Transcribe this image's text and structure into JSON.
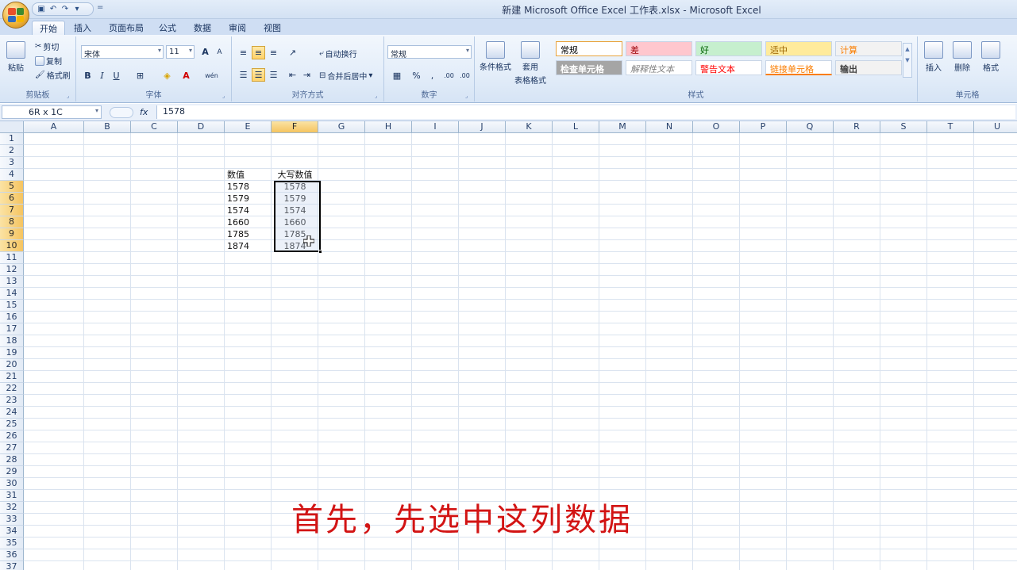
{
  "window": {
    "title": "新建 Microsoft Office Excel 工作表.xlsx - Microsoft Excel"
  },
  "qat": {
    "more": "="
  },
  "tabs": [
    "开始",
    "插入",
    "页面布局",
    "公式",
    "数据",
    "审阅",
    "视图"
  ],
  "ribbon": {
    "clipboard": {
      "label": "剪贴板",
      "paste": "粘贴",
      "cut": "剪切",
      "copy": "复制",
      "format_painter": "格式刷"
    },
    "font": {
      "label": "字体",
      "name": "宋体",
      "size": "11",
      "grow": "A",
      "shrink": "A",
      "bold": "B",
      "italic": "I",
      "underline": "U",
      "phonetic": "wén"
    },
    "alignment": {
      "label": "对齐方式",
      "wrap_text": "自动换行",
      "merge_center": "合并后居中"
    },
    "number": {
      "label": "数字",
      "format": "常规",
      "percent": "%",
      "comma": ",",
      "inc_decimal": ".00",
      "dec_decimal": ".00"
    },
    "styles": {
      "label": "样式",
      "conditional_format": "条件格式",
      "table_format_line1": "套用",
      "table_format_line2": "表格格式",
      "gallery": [
        {
          "name": "常规",
          "bg": "#ffffff",
          "color": "#000000"
        },
        {
          "name": "差",
          "bg": "#ffc7ce",
          "color": "#9c0006"
        },
        {
          "name": "好",
          "bg": "#c6efce",
          "color": "#006100"
        },
        {
          "name": "适中",
          "bg": "#ffeb9c",
          "color": "#9c6500"
        },
        {
          "name": "计算",
          "bg": "#f2f2f2",
          "color": "#fa7d00"
        },
        {
          "name": "检查单元格",
          "bg": "#a5a5a5",
          "color": "#ffffff"
        },
        {
          "name": "解释性文本",
          "bg": "#ffffff",
          "color": "#7f7f7f"
        },
        {
          "name": "警告文本",
          "bg": "#ffffff",
          "color": "#ff0000"
        },
        {
          "name": "链接单元格",
          "bg": "#ffffff",
          "color": "#fa7d00"
        },
        {
          "name": "输出",
          "bg": "#f2f2f2",
          "color": "#3f3f3f"
        }
      ]
    },
    "cells": {
      "label": "单元格",
      "insert": "插入",
      "delete": "删除",
      "format": "格式"
    }
  },
  "formula_bar": {
    "name_box": "6R x 1C",
    "fx": "fx",
    "value": "1578"
  },
  "columns": [
    "A",
    "B",
    "C",
    "D",
    "E",
    "F",
    "G",
    "H",
    "I",
    "J",
    "K",
    "L",
    "M",
    "N",
    "O",
    "P",
    "Q",
    "R",
    "S",
    "T",
    "U"
  ],
  "selected_column": "F",
  "rows": [
    "1",
    "2",
    "3",
    "4",
    "5",
    "6",
    "7",
    "8",
    "9",
    "10",
    "11",
    "12",
    "13",
    "14",
    "15",
    "16",
    "17",
    "18",
    "19",
    "20",
    "21",
    "22",
    "23",
    "24",
    "25",
    "26",
    "27",
    "28",
    "29",
    "30",
    "31",
    "32",
    "33",
    "34",
    "35",
    "36",
    "37"
  ],
  "selected_rows": [
    "5",
    "6",
    "7",
    "8",
    "9",
    "10"
  ],
  "sheet": {
    "header_e": "数值",
    "header_f": "大写数值",
    "values_e": [
      "1578",
      "1579",
      "1574",
      "1660",
      "1785",
      "1874"
    ],
    "values_f": [
      "1578",
      "1579",
      "1574",
      "1660",
      "1785",
      "1874"
    ]
  },
  "caption": "首先，先选中这列数据"
}
